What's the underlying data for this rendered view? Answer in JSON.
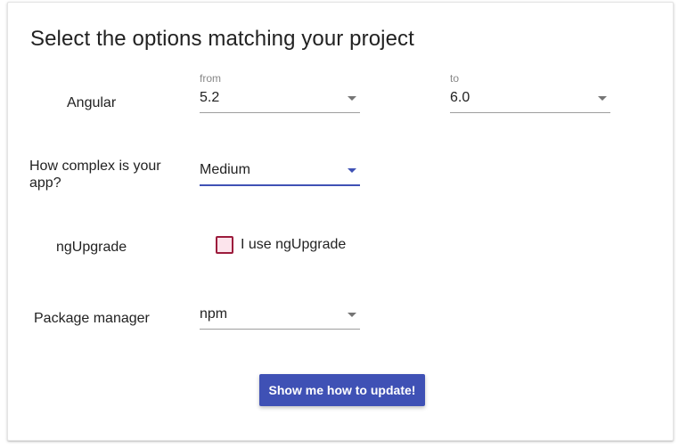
{
  "page": {
    "title": "Select the options matching your project"
  },
  "angular": {
    "label": "Angular",
    "from": {
      "label": "from",
      "value": "5.2"
    },
    "to": {
      "label": "to",
      "value": "6.0"
    }
  },
  "complexity": {
    "label": "How complex is your app?",
    "value": "Medium"
  },
  "ngupgrade": {
    "label": "ngUpgrade",
    "checkbox_label": "I use ngUpgrade",
    "checked": false
  },
  "package_manager": {
    "label": "Package manager",
    "value": "npm"
  },
  "action": {
    "button_label": "Show me how to update!"
  },
  "colors": {
    "accent": "#3f51b5",
    "checkbox_border": "#9c1c3c",
    "checkbox_fill": "#fce4ec"
  }
}
